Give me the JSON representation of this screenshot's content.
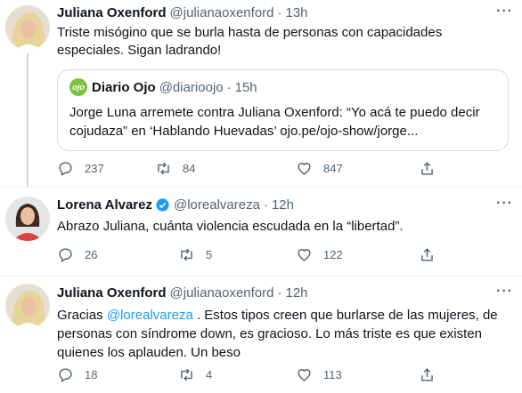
{
  "tweets": [
    {
      "name": "Juliana Oxenford",
      "handle": "@julianaoxenford",
      "time": "13h",
      "text": "Triste misógino que se burla hasta de personas con capacidades especiales. Sigan ladrando!",
      "quote": {
        "logo": "ojo",
        "name": "Diario Ojo",
        "handle": "@diarioojo",
        "time": "15h",
        "text": "Jorge Luna arremete contra Juliana Oxenford: “Yo acá te puedo decir cojudaza” en ‘Hablando Huevadas’ ojo.pe/ojo-show/jorge..."
      },
      "replies": "237",
      "retweets": "84",
      "likes": "847"
    },
    {
      "name": "Lorena Alvarez",
      "verified": true,
      "handle": "@lorealvareza",
      "time": "12h",
      "text": "Abrazo Juliana, cuánta violencia escudada en la “libertad”.",
      "replies": "26",
      "retweets": "5",
      "likes": "122"
    },
    {
      "name": "Juliana Oxenford",
      "handle": "@julianaoxenford",
      "time": "12h",
      "text_before": "Gracias ",
      "mention": "@lorealvareza",
      "text_after": " . Estos tipos creen que burlarse de las mujeres, de personas con síndrome down, es gracioso. Lo más triste es que existen quienes los aplauden. Un beso",
      "replies": "18",
      "retweets": "4",
      "likes": "113"
    }
  ],
  "dot": "·",
  "more": "···",
  "colors": {
    "accent": "#1d9bf0",
    "muted": "#536471",
    "border": "#cfd9de"
  },
  "icons": [
    "reply-icon",
    "retweet-icon",
    "like-icon",
    "share-icon",
    "verified-icon",
    "more-icon"
  ]
}
